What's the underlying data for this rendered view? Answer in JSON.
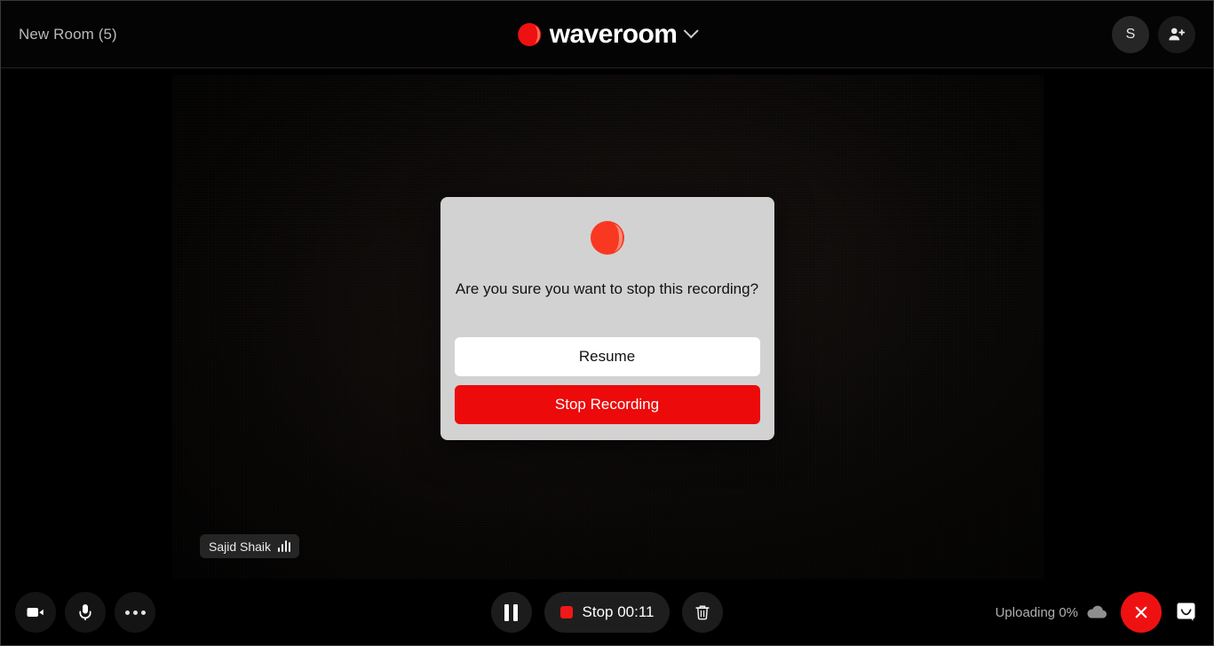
{
  "header": {
    "room_title": "New Room (5)",
    "brand_name": "waveroom",
    "brand_logo_icon": "waveroom-logo-icon",
    "chevron_icon": "chevron-down-icon",
    "avatar_initial": "S",
    "add_person_icon": "add-person-icon"
  },
  "stage": {
    "participant": {
      "name": "Sajid Shaik",
      "audio_icon": "audio-level-icon"
    }
  },
  "modal": {
    "logo_icon": "waveroom-record-icon",
    "message": "Are you sure you want to stop this recording?",
    "resume_label": "Resume",
    "stop_label": "Stop Recording"
  },
  "footer": {
    "camera_icon": "video-camera-icon",
    "mic_icon": "microphone-icon",
    "more_icon": "more-options-icon",
    "pause_icon": "pause-icon",
    "stop_label": "Stop 00:11",
    "stop_record_icon": "record-stop-square-icon",
    "delete_icon": "trash-icon",
    "upload_status": "Uploading 0%",
    "cloud_icon": "cloud-upload-icon",
    "end_call_icon": "close-x-icon",
    "chat_icon": "reactions-icon"
  },
  "colors": {
    "brand_red": "#ee1111",
    "modal_bg": "#d2d2d2",
    "stop_button": "#ec0a0a",
    "end_call": "#ef1111"
  }
}
